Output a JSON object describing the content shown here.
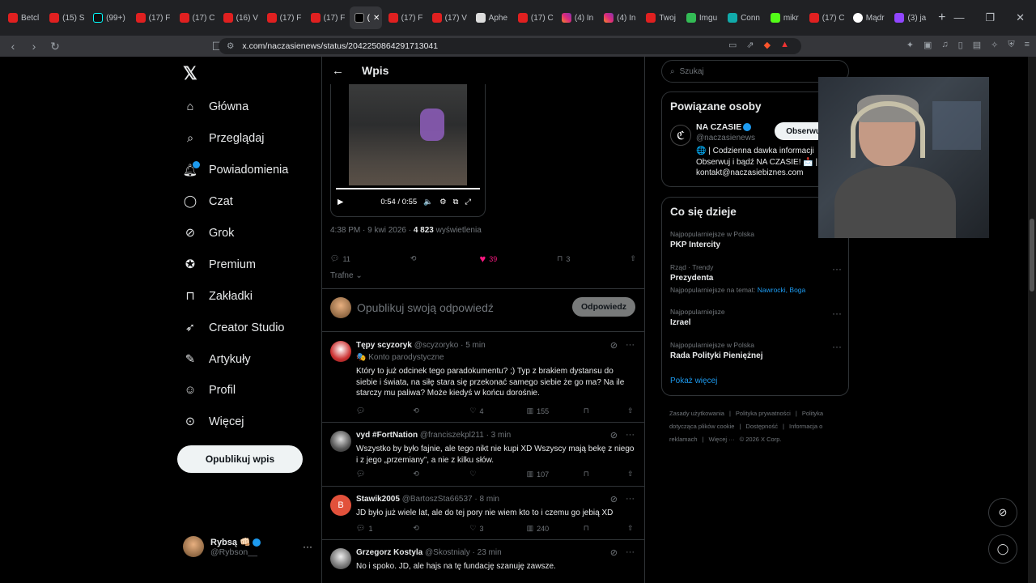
{
  "browser": {
    "tabs": [
      {
        "label": "Betcl",
        "fav": "yt"
      },
      {
        "label": "(15) S",
        "fav": "yt"
      },
      {
        "label": "(99+)",
        "fav": "tt"
      },
      {
        "label": "(17) F",
        "fav": "yt"
      },
      {
        "label": "(17) C",
        "fav": "yt"
      },
      {
        "label": "(16) V",
        "fav": "yt"
      },
      {
        "label": "(17) F",
        "fav": "yt"
      },
      {
        "label": "(17) F",
        "fav": "yt"
      },
      {
        "label": "(",
        "fav": "x",
        "active": true
      },
      {
        "label": "(17) F",
        "fav": "yt"
      },
      {
        "label": "(17) V",
        "fav": "yt"
      },
      {
        "label": "Aphe",
        "fav": "wh"
      },
      {
        "label": "(17) C",
        "fav": "yt"
      },
      {
        "label": "(4) In",
        "fav": "ig"
      },
      {
        "label": "(4) In",
        "fav": "ig"
      },
      {
        "label": "Twoj",
        "fav": "yt"
      },
      {
        "label": "Imgu",
        "fav": "gr"
      },
      {
        "label": "Conn",
        "fav": "cy"
      },
      {
        "label": "mikr",
        "fav": "kk"
      },
      {
        "label": "(17) C",
        "fav": "yt"
      },
      {
        "label": "Mądr",
        "fav": "gg"
      },
      {
        "label": "(3) ja",
        "fav": "pp"
      }
    ],
    "url": "x.com/naczasienews/status/2042250864291713041"
  },
  "sidebar": {
    "items": [
      {
        "label": "Główna",
        "icon": "home-icon"
      },
      {
        "label": "Przeglądaj",
        "icon": "search-icon"
      },
      {
        "label": "Powiadomienia",
        "icon": "bell-icon",
        "badge": "1"
      },
      {
        "label": "Czat",
        "icon": "chat-icon"
      },
      {
        "label": "Grok",
        "icon": "grok-icon"
      },
      {
        "label": "Premium",
        "icon": "premium-icon"
      },
      {
        "label": "Zakładki",
        "icon": "bookmark-icon"
      },
      {
        "label": "Creator Studio",
        "icon": "rocket-icon"
      },
      {
        "label": "Artykuły",
        "icon": "article-icon"
      },
      {
        "label": "Profil",
        "icon": "person-icon"
      },
      {
        "label": "Więcej",
        "icon": "more-circle-icon"
      }
    ],
    "publish_label": "Opublikuj wpis",
    "account": {
      "name": "Rybsą 👊🏻",
      "handle": "@Rybson__"
    }
  },
  "main": {
    "header_title": "Wpis",
    "video": {
      "time": "0:54 / 0:55"
    },
    "meta": {
      "time": "4:38 PM · 9 kwi 2026 · ",
      "views": "4 823",
      "views_label": " wyświetlenia"
    },
    "actions": {
      "replies": "11",
      "retweets": "",
      "likes": "39",
      "bookmarks": "3"
    },
    "sort_label": "Trafne",
    "reply_placeholder": "Opublikuj swoją odpowiedź",
    "reply_button": "Odpowiedz",
    "replies": [
      {
        "name": "Tępy scyzoryk",
        "handle": "@scyzoryko · 5 min",
        "sub": "🎭 Konto parodystyczne",
        "text": "Który to już odcinek tego paradokumentu? ;) Typ z brakiem dystansu do siebie i świata, na siłę stara się przekonać samego siebie że go ma? Na ile starczy mu paliwa? Może kiedyś w końcu dorośnie.",
        "replies": "",
        "retweets": "",
        "likes": "4",
        "views": "155"
      },
      {
        "name": "vyd #FortNation",
        "handle": "@franciszekpl211 · 3 min",
        "sub": "",
        "text": "Wszystko by było fajnie, ale tego nikt nie kupi XD Wszyscy mają bekę z niego i z jego „przemiany”, a nie z kilku słów.",
        "replies": "",
        "retweets": "",
        "likes": "",
        "views": "107"
      },
      {
        "name": "Stawik2005",
        "handle": "@BartoszSta66537 · 8 min",
        "sub": "",
        "text": "JD było już wiele lat, ale do tej pory nie wiem kto to i czemu go jebią XD",
        "replies": "1",
        "retweets": "",
        "likes": "3",
        "views": "240"
      },
      {
        "name": "Grzegorz Kostyla",
        "handle": "@Skostnialy · 23 min",
        "sub": "",
        "text": "No i spoko. JD, ale hajs na tę fundację szanuję zawsze.",
        "replies": "",
        "retweets": "",
        "likes": "",
        "views": ""
      }
    ]
  },
  "right": {
    "search_placeholder": "Szukaj",
    "related": {
      "title": "Powiązane osoby",
      "name": "NA CZASIE",
      "handle": "@naczasienews",
      "follow": "Obserwuj",
      "bio": "🌐 | Codzienna dawka informacji Obserwuj i bądź NA CZASIE! 📩 | kontakt@naczasiebiznes.com"
    },
    "trends_title": "Co się dzieje",
    "trends": [
      {
        "cat": "Najpopularniejsze w Polska",
        "topic": "PKP Intercity",
        "extra": ""
      },
      {
        "cat": "Rząd · Trendy",
        "topic": "Prezydenta",
        "extra": "Najpopularniejsze na temat: ",
        "extra_links": "Nawrocki, Boga"
      },
      {
        "cat": "Najpopularniejsze",
        "topic": "Izrael",
        "extra": ""
      },
      {
        "cat": "Najpopularniejsze w Polska",
        "topic": "Rada Polityki Pieniężnej",
        "extra": ""
      }
    ],
    "show_more": "Pokaż więcej",
    "footer": [
      "Zasady użytkowania",
      "|",
      "Polityka prywatności",
      "|",
      "Polityka dotycząca plików cookie",
      "|",
      "Dostępność",
      "|",
      "Informacja o reklamach",
      "|",
      "Więcej ···",
      "© 2026 X Corp."
    ]
  },
  "colors": {
    "accent": "#1d9bf0",
    "like": "#f91880",
    "background": "#000000",
    "border": "#2f3336"
  }
}
